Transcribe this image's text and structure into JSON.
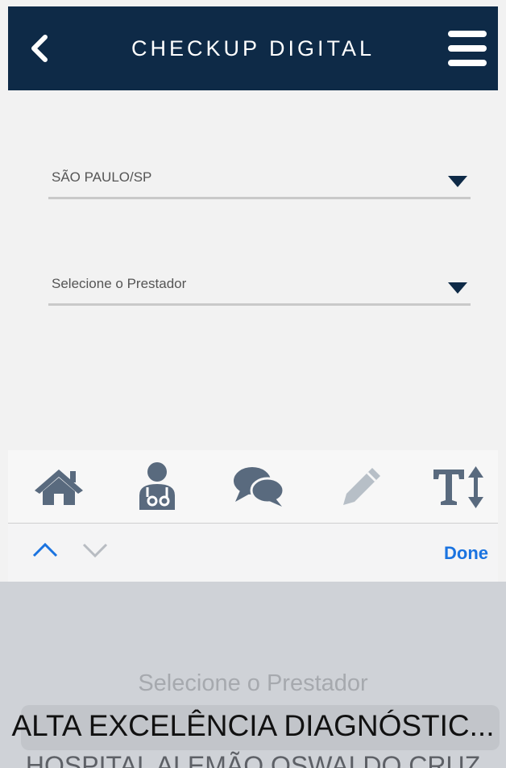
{
  "header": {
    "title": "CHECKUP DIGITAL",
    "back_icon": "chevron-left-icon",
    "menu_icon": "hamburger-menu-icon"
  },
  "form": {
    "city_select": {
      "value": "SÃO PAULO/SP"
    },
    "provider_select": {
      "value": "Selecione o Prestador"
    }
  },
  "toolbar": {
    "items": [
      {
        "icon": "home-icon"
      },
      {
        "icon": "doctor-icon"
      },
      {
        "icon": "chat-icon"
      },
      {
        "icon": "pencil-icon",
        "disabled": true
      },
      {
        "icon": "text-size-icon"
      }
    ]
  },
  "keyboard_accessory": {
    "done_label": "Done"
  },
  "picker": {
    "options": [
      "Selecione o Prestador",
      "ALTA EXCELÊNCIA DIAGNÓSTIC...",
      "HOSPITAL ALEMÃO OSWALDO CRUZ"
    ],
    "selected_index": 1
  },
  "colors": {
    "header_bg": "#0e2a47",
    "accent_blue": "#1a73e0",
    "icon_slate": "#596a7e"
  }
}
